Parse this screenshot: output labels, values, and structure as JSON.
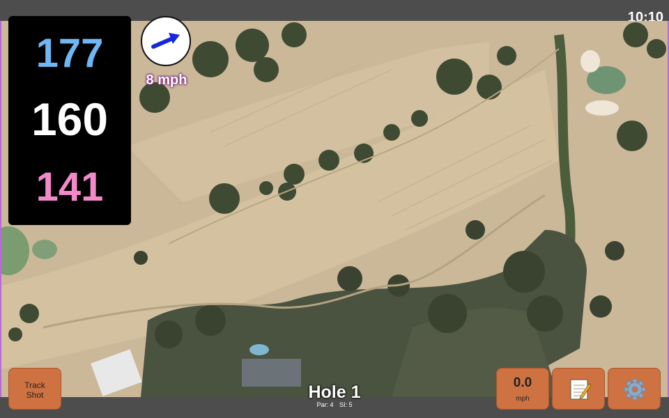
{
  "status_bar": {
    "time": "10:10"
  },
  "distances": {
    "back": "177",
    "middle": "160",
    "front": "141"
  },
  "wind": {
    "speed": "8 mph",
    "icon": "wind-direction-arrow-icon"
  },
  "buttons": {
    "track_shot": {
      "line1": "Track",
      "line2": "Shot"
    },
    "speed": {
      "value": "0.0",
      "unit": "mph"
    },
    "notes_icon": "notepad-icon",
    "settings_icon": "gear-icon"
  },
  "hole": {
    "title": "Hole 1",
    "par": "Par: 4",
    "si": "SI: 5"
  },
  "colors": {
    "back_distance": "#6fb6f4",
    "middle_distance": "#ffffff",
    "front_distance": "#f28ac9",
    "button": "#cf7241",
    "wind_arrow": "#1428d8"
  }
}
